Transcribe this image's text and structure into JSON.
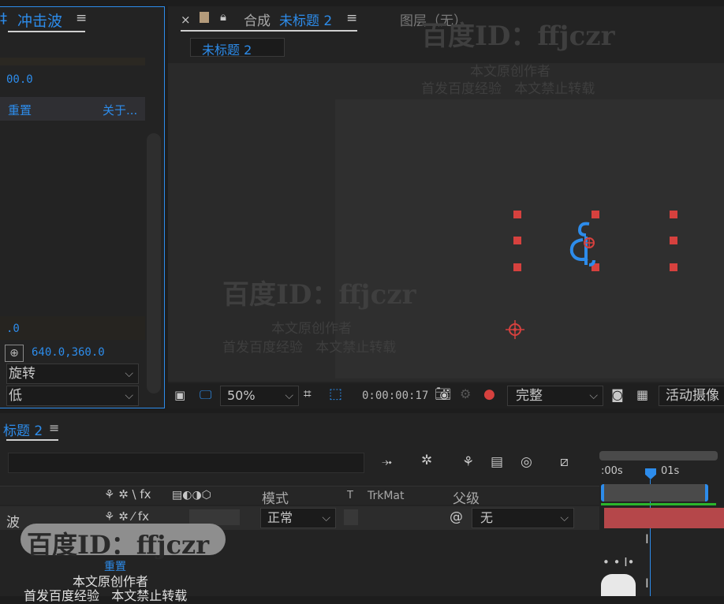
{
  "effect_panel": {
    "tab_prefix": "‡",
    "tab_title": "冲击波",
    "menu_icon": "hamburger-icon",
    "value_1": "00.0",
    "reset_label": "重置",
    "about_label": "关于...",
    "value_2": ".0",
    "point_value": "640.0,360.0",
    "dropdown_1": "旋转",
    "dropdown_2": "低"
  },
  "comp_panel": {
    "close_glyph": "×",
    "lock_icon": "lock-icon",
    "comp_prefix": "合成",
    "comp_name": "未标题 2",
    "layer_tab": "图层（无）",
    "sub_tab": "未标题 2",
    "toolbar": {
      "zoom": "50%",
      "timecode": "0:00:00:17",
      "resolution": "完整",
      "camera": "活动摄像"
    }
  },
  "timeline": {
    "tab_title": "标题 2",
    "columns": {
      "icons": "⚘ ✲ \\ fx",
      "mode": "模式",
      "t": "T",
      "trkmat": "TrkMat",
      "parent": "父级"
    },
    "layer_name": "波",
    "layer_mode": "正常",
    "layer_parent": "无",
    "reset_label": "重置",
    "ruler_start": ":00s",
    "ruler_01": "01s"
  },
  "watermarks": {
    "title": "百度ID：ffjczr",
    "line1": "本文原创作者",
    "line2": "首发百度经验   本文禁止转载"
  },
  "colors": {
    "accent": "#2d8ceb",
    "handle": "#d6413e",
    "bar": "#b5474a"
  }
}
